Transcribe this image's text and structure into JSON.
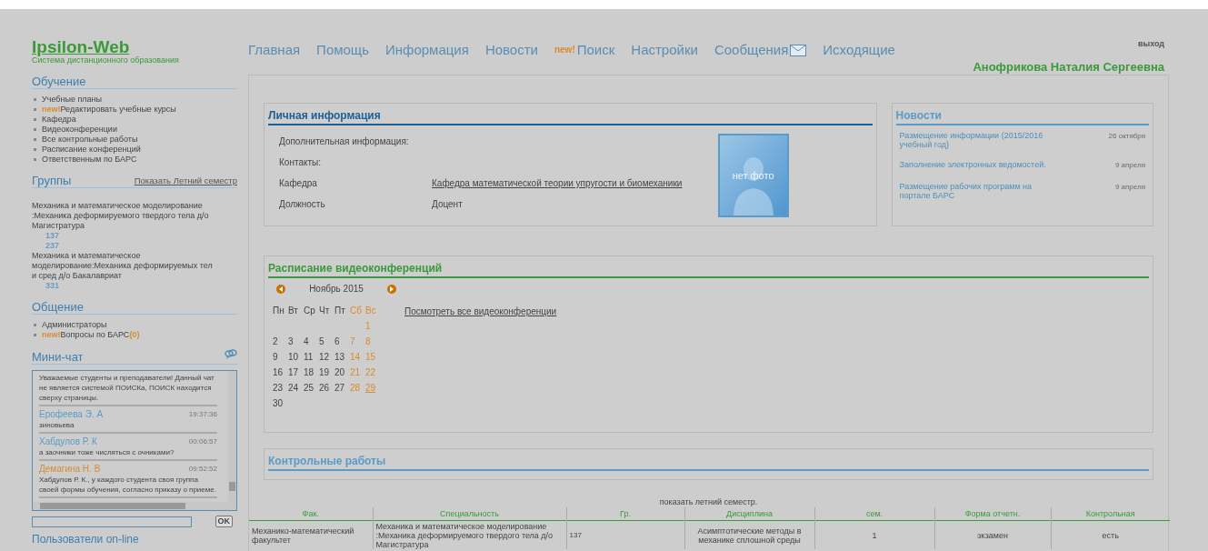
{
  "logo": {
    "title": "Ipsilon-Web",
    "subtitle": "Система дистанционного образования"
  },
  "nav": [
    {
      "label": "Главная",
      "kind": "plain"
    },
    {
      "label": "Помощь",
      "kind": "plain"
    },
    {
      "label": "Информация",
      "kind": "plain"
    },
    {
      "label": "Новости",
      "kind": "plain"
    },
    {
      "label": "Поиск",
      "badge": "new!",
      "kind": "plain"
    },
    {
      "label": "Настройки",
      "kind": "plain"
    },
    {
      "label": "Сообщения",
      "kind": "envelope"
    },
    {
      "label": "Исходящие",
      "kind": "plain"
    }
  ],
  "logout": "выход",
  "user_name": "Анофрикова Наталия Сергеевна",
  "sidebar": {
    "study": {
      "title": "Обучение",
      "items": [
        {
          "label": "Учебные планы"
        },
        {
          "label": "Редактировать учебные курсы",
          "badge": "new!"
        },
        {
          "label": "Кафедра"
        },
        {
          "label": "Видеоконференции"
        },
        {
          "label": "Все контрольные работы"
        },
        {
          "label": "Расписание конференций"
        },
        {
          "label": "Ответственным по БАРС"
        }
      ]
    },
    "groups": {
      "title": "Группы",
      "link": "Показать Летний семестр",
      "items": [
        {
          "name": "Механика и математическое моделирование :Механика деформируемого твердого тела д/о Магистратура",
          "numbers": [
            "137",
            "237"
          ]
        },
        {
          "name": "Механика и математическое моделирование:Механика деформируемых тел и сред д/о Бакалавриат",
          "numbers": [
            "331"
          ]
        }
      ]
    },
    "communication": {
      "title": "Общение",
      "items": [
        {
          "label": "Администраторы"
        },
        {
          "label": "Вопросы по БАРС",
          "badge": "new!",
          "count": "(0)"
        }
      ]
    },
    "chat": {
      "title": "Мини-чат",
      "messages": [
        {
          "text": "Уважаемые студенты и преподаватели! Данный чат не является системой ПОИСКа, ПОИСК находится сверху страницы."
        },
        {
          "author": "Ерофеева Э. А",
          "time": "19:37:36",
          "color": "#5b9bc8",
          "text": "зиновьева"
        },
        {
          "author": "Хабдулов Р. К",
          "time": "00:06:57",
          "color": "#5b9bc8",
          "text": "а заочники тоже числяться с очниками?"
        },
        {
          "author": "Демагина Н. В",
          "time": "09:52:52",
          "color": "#d98b2b",
          "text": "Хабдулов Р. К., у каждого студента своя группа своей формы обучения, согласно приказу о приеме."
        }
      ],
      "send": "OK"
    },
    "online_title": "Пользователи on-line"
  },
  "personal": {
    "title": "Личная информация",
    "rows": [
      {
        "label": "Дополнительная информация:"
      },
      {
        "label": "Контакты:"
      },
      {
        "label": "Кафедра",
        "value": "Кафедра математической теории упругости и биомеханики",
        "link": true
      },
      {
        "label": "Должность",
        "value": "Доцент",
        "link": false
      }
    ],
    "photo_text": "нет фото"
  },
  "news": {
    "title": "Новости",
    "items": [
      {
        "title": "Размещение информации (2015/2016 учебный год)",
        "date": "26 октября"
      },
      {
        "title": "Заполнение электронных ведомостей.",
        "date": "9 апреля"
      },
      {
        "title": "Размещение рабочих программ на портале БАРС",
        "date": "9 апреля"
      }
    ]
  },
  "video": {
    "title": "Расписание видеоконференций",
    "month": "Ноябрь 2015",
    "all_link": "Посмотреть все видеоконференции",
    "weekdays": [
      {
        "label": "Пн",
        "weekend": false
      },
      {
        "label": "Вт",
        "weekend": false
      },
      {
        "label": "Ср",
        "weekend": false
      },
      {
        "label": "Чт",
        "weekend": false
      },
      {
        "label": "Пт",
        "weekend": false
      },
      {
        "label": "Сб",
        "weekend": true
      },
      {
        "label": "Вс",
        "weekend": true
      }
    ],
    "weeks": [
      [
        {
          "day": "1",
          "weekend": true,
          "link": false
        }
      ],
      [
        {
          "day": "2",
          "weekend": false,
          "link": false
        },
        {
          "day": "3",
          "weekend": false,
          "link": false
        },
        {
          "day": "4",
          "weekend": false,
          "link": false
        },
        {
          "day": "5",
          "weekend": false,
          "link": false
        },
        {
          "day": "6",
          "weekend": false,
          "link": false
        },
        {
          "day": "7",
          "weekend": true,
          "link": false
        },
        {
          "day": "8",
          "weekend": true,
          "link": false
        }
      ],
      [
        {
          "day": "9",
          "weekend": false,
          "link": false
        },
        {
          "day": "10",
          "weekend": false,
          "link": false
        },
        {
          "day": "11",
          "weekend": false,
          "link": false
        },
        {
          "day": "12",
          "weekend": false,
          "link": false
        },
        {
          "day": "13",
          "weekend": false,
          "link": false
        },
        {
          "day": "14",
          "weekend": true,
          "link": false
        },
        {
          "day": "15",
          "weekend": true,
          "link": false
        }
      ],
      [
        {
          "day": "16",
          "weekend": false,
          "link": false
        },
        {
          "day": "17",
          "weekend": false,
          "link": false
        },
        {
          "day": "18",
          "weekend": false,
          "link": false
        },
        {
          "day": "19",
          "weekend": false,
          "link": false
        },
        {
          "day": "20",
          "weekend": false,
          "link": false
        },
        {
          "day": "21",
          "weekend": true,
          "link": false
        },
        {
          "day": "22",
          "weekend": true,
          "link": false
        }
      ],
      [
        {
          "day": "23",
          "weekend": false,
          "link": false
        },
        {
          "day": "24",
          "weekend": false,
          "link": false
        },
        {
          "day": "25",
          "weekend": false,
          "link": false
        },
        {
          "day": "26",
          "weekend": false,
          "link": false
        },
        {
          "day": "27",
          "weekend": false,
          "link": false
        },
        {
          "day": "28",
          "weekend": true,
          "link": false
        },
        {
          "day": "29",
          "weekend": true,
          "link": true
        }
      ],
      [
        {
          "day": "30",
          "weekend": false,
          "link": false
        }
      ]
    ]
  },
  "control": {
    "title": "Контрольные работы",
    "summer_link": "показать летний семестр.",
    "columns": [
      "Фак.",
      "Специальность",
      "Гр.",
      "Дисциплина",
      "сем.",
      "Форма отчетн.",
      "Контрольная"
    ],
    "rows": [
      [
        "Механико-математический факультет",
        "Механика и математическое моделирование :Механика деформируемого твердого тела д/о Магистратура",
        "137",
        "Асимптотические методы в механике сплошной среды",
        "1",
        "экзамен",
        "есть"
      ]
    ]
  }
}
